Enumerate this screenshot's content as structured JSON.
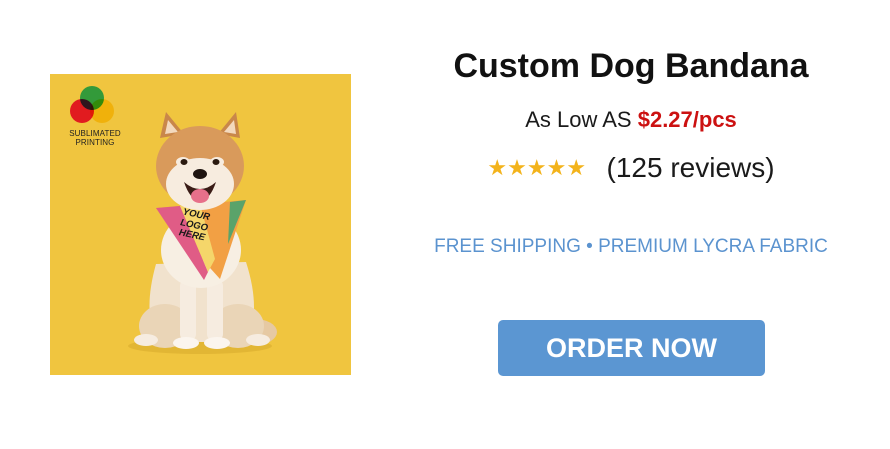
{
  "product": {
    "image": {
      "badge_label": "SUBLIMATED PRINTING",
      "logo_overlay_text": "YOUR LOGO HERE",
      "background_color": "#f0c53f"
    },
    "title": "Custom Dog Bandana",
    "price": {
      "prefix": "As Low AS",
      "value": "$2.27/pcs"
    },
    "rating": {
      "stars": "★★★★★",
      "value": 5,
      "max": 5,
      "reviews": "(125 reviews)"
    },
    "features": "FREE SHIPPING • PREMIUM LYCRA FABRIC",
    "cta": {
      "label": "ORDER NOW"
    }
  },
  "colors": {
    "price_accent": "#cc1111",
    "star": "#f3b31b",
    "feature_text": "#5b93cf",
    "button": "#5b96d2"
  }
}
